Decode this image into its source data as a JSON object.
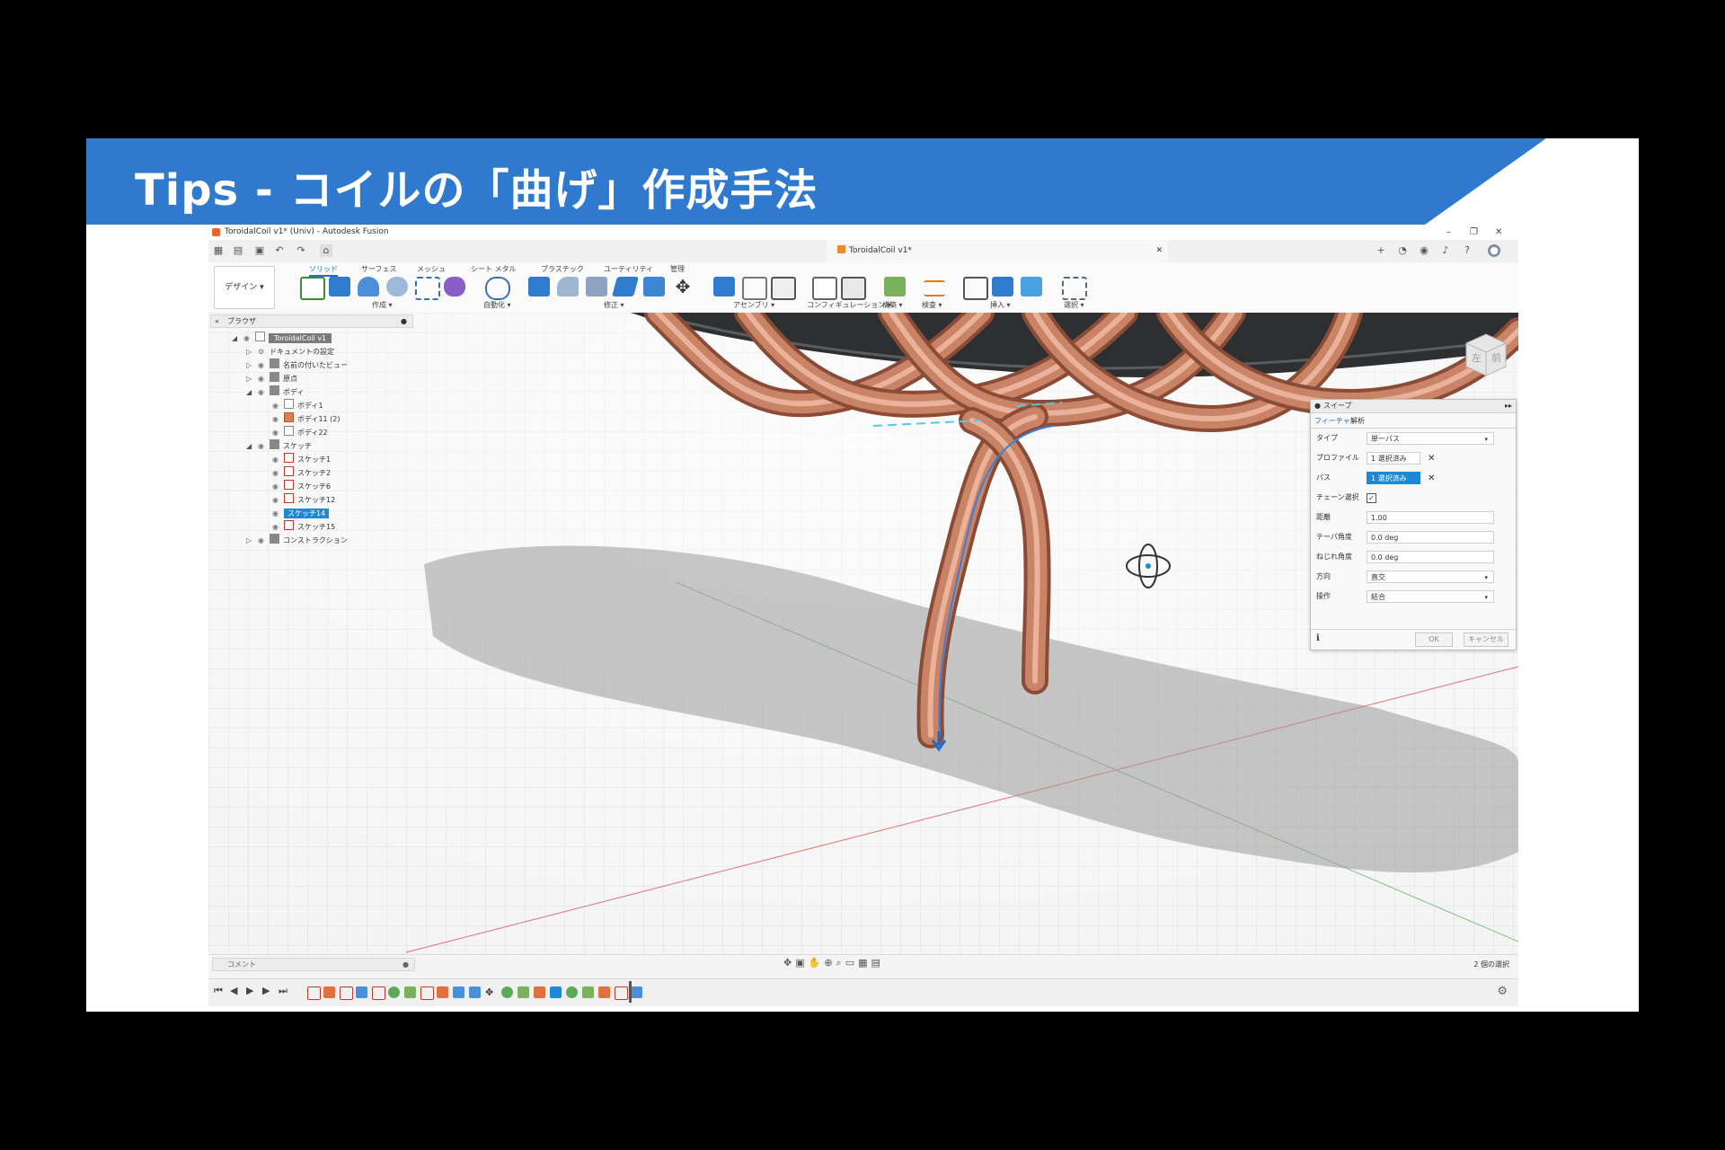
{
  "slide": {
    "title": "Tips - コイルの「曲げ」作成手法",
    "banner_color": "#2f79cf"
  },
  "window": {
    "title": "ToroidalCoil v1* (Univ) - Autodesk Fusion",
    "doc_tab": "ToroidalCoil v1*",
    "controls": [
      "–",
      "❐",
      "✕"
    ]
  },
  "ribbon": {
    "workspace": "デザイン ▾",
    "tabs": [
      "ソリッド",
      "サーフェス",
      "メッシュ",
      "シート メタル",
      "プラスチック",
      "ユーティリティ",
      "管理"
    ],
    "groups": [
      "作成 ▾",
      "自動化 ▾",
      "修正 ▾",
      "アセンブリ ▾",
      "コンフィギュレーション ▾",
      "構築 ▾",
      "検査 ▾",
      "挿入 ▾",
      "選択 ▾"
    ]
  },
  "browser": {
    "header": "ブラウザ",
    "items": [
      {
        "label": "ToroidalCoil v1",
        "level": 0
      },
      {
        "label": "ドキュメントの設定",
        "level": 1
      },
      {
        "label": "名前の付いたビュー",
        "level": 1
      },
      {
        "label": "原点",
        "level": 1
      },
      {
        "label": "ボディ",
        "level": 1
      },
      {
        "label": "ボディ1",
        "level": 2
      },
      {
        "label": "ボディ11 (2)",
        "level": 2
      },
      {
        "label": "ボディ22",
        "level": 2
      },
      {
        "label": "スケッチ",
        "level": 1
      },
      {
        "label": "スケッチ1",
        "level": 2
      },
      {
        "label": "スケッチ2",
        "level": 2
      },
      {
        "label": "スケッチ6",
        "level": 2
      },
      {
        "label": "スケッチ12",
        "level": 2
      },
      {
        "label": "スケッチ14",
        "level": 2
      },
      {
        "label": "スケッチ15",
        "level": 2
      },
      {
        "label": "コンストラクション",
        "level": 1
      }
    ]
  },
  "viewcube": {
    "left": "左",
    "front": "前"
  },
  "sweep": {
    "title": "スイープ",
    "tabs": [
      "フィーチャ",
      "解析"
    ],
    "type_label": "タイプ",
    "type_value": "単一パス",
    "profile_label": "プロファイル",
    "profile_value": "1 選択済み",
    "path_label": "パス",
    "path_value": "1 選択済み",
    "chain_label": "チェーン選択",
    "chain_check": "✓",
    "distance_label": "距離",
    "distance_value": "1.00",
    "taper_label": "テーパ角度",
    "taper_value": "0.0 deg",
    "twist_label": "ねじれ角度",
    "twist_value": "0.0 deg",
    "orient_label": "方向",
    "orient_value": "直交",
    "op_label": "操作",
    "op_value": "結合",
    "ok": "OK",
    "cancel": "キャンセル"
  },
  "status": {
    "comment": "コメント",
    "selection": "2 個の選択"
  },
  "colors": {
    "copper": "#c27a5c",
    "selection_blue": "#1e88d8",
    "accent": "#1e6ec8"
  }
}
